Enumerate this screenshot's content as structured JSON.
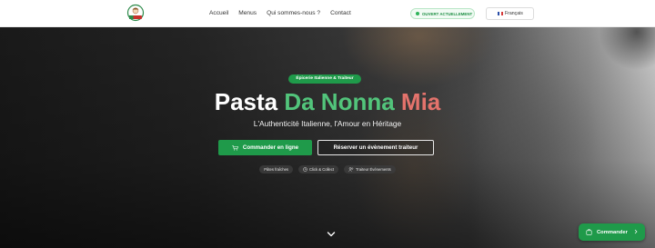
{
  "header": {
    "logo_icon": "pasta-da-nonna-mia-logo",
    "nav": [
      {
        "label": "Accueil"
      },
      {
        "label": "Menus"
      },
      {
        "label": "Qui sommes-nous ?"
      },
      {
        "label": "Contact"
      }
    ],
    "status_badge": "OUVERT ACTUELLEMENT",
    "language": "Français",
    "language_flag_icon": "flag-fr-icon"
  },
  "hero": {
    "tagline": "Épicerie Italienne & Traiteur",
    "title_part1": "Pasta ",
    "title_part2": "Da Nonna ",
    "title_part3": "Mia",
    "subtitle": "L'Authenticité Italienne, l'Amour en Héritage",
    "order_button": "Commander en ligne",
    "order_icon": "cart-icon",
    "event_button": "Réserver un évènement traiteur",
    "chips": [
      {
        "label": "Pâtes fraîches",
        "icon": ""
      },
      {
        "label": "Click & Collect",
        "icon": "clock-icon"
      },
      {
        "label": "Traiteur Événements",
        "icon": "users-icon"
      }
    ],
    "scroll_icon": "chevron-down-icon"
  },
  "floating": {
    "label": "Commander",
    "icon": "bag-icon",
    "arrow_icon": "chevron-right-icon"
  },
  "colors": {
    "brand_green": "#1f9a4a",
    "title_green": "#52c47b",
    "title_red": "#e4736c"
  }
}
